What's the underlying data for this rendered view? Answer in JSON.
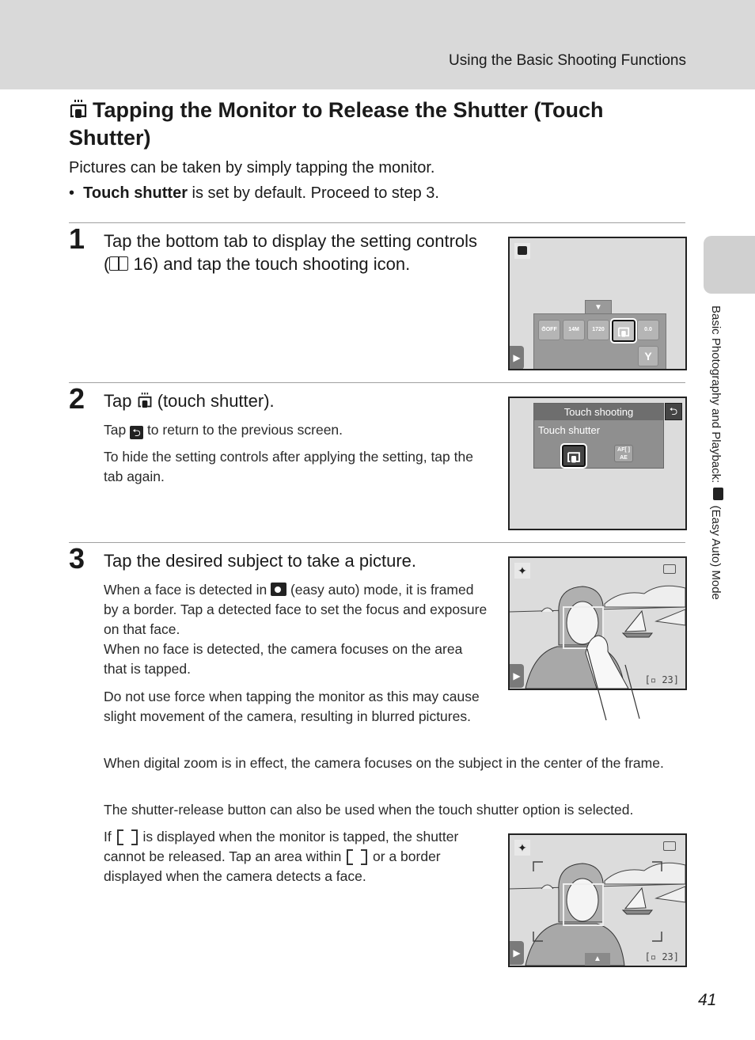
{
  "header": {
    "running_head": "Using the Basic Shooting Functions"
  },
  "side_tab": {
    "section_text_before": "Basic Photography and Playback: ",
    "section_icon": "easy-auto-camera-icon",
    "section_text_after": " (Easy Auto) Mode"
  },
  "title": {
    "icon": "touch-shutter-icon",
    "text": "Tapping the Monitor to Release the Shutter (Touch Shutter)"
  },
  "intro": "Pictures can be taken by simply tapping the monitor.",
  "bullet": {
    "bold": "Touch shutter",
    "rest": " is set by default. Proceed to step 3."
  },
  "steps": [
    {
      "number": "1",
      "title": "Tap the bottom tab to display the setting controls (",
      "ref_icon": "book-reference-icon",
      "title_ref": " 16) and tap the touch shooting icon.",
      "screen": {
        "buttons": [
          {
            "icon": "self-timer-icon",
            "value": "OFF"
          },
          {
            "icon": "image-mode-icon",
            "value": "14M"
          },
          {
            "icon": "movie-icon",
            "value": "1720"
          },
          {
            "icon": "touch-shutter-icon",
            "value": "",
            "selected": true
          },
          {
            "icon": "exposure-compensation-icon",
            "value": "0.0"
          }
        ],
        "setup_icon": "wrench-icon"
      }
    },
    {
      "number": "2",
      "title_before": "Tap ",
      "title_after": " (touch shutter).",
      "para1_before": "Tap ",
      "para1_after": " to return to the previous screen.",
      "para2": "To hide the setting controls after applying the setting, tap the tab again.",
      "screen": {
        "menu_title": "Touch shooting",
        "option_label": "Touch shutter",
        "option2_text": "AF[ ] AE"
      }
    },
    {
      "number": "3",
      "title": "Tap the desired subject to take a picture.",
      "para1_before": "When a face is detected in ",
      "para1_after": " (easy auto) mode, it is framed by a border. Tap a detected face to set the focus and exposure on that face.",
      "para1b": "When no face is detected, the camera focuses on the area that is tapped.",
      "para2": "Do not use force when tapping the monitor as this may cause slight movement of the camera, resulting in blurred pictures.",
      "para3": "When digital zoom is in effect, the camera focuses on the subject in the center of the frame.",
      "para4": "The shutter-release button can also be used when the touch shutter option is selected.",
      "para5_a": "If ",
      "para5_b": " is displayed when the monitor is tapped, the shutter cannot be released. Tap an area within ",
      "para5_c": " or a border displayed when the camera detects a face.",
      "screen": {
        "frames_remaining": "23"
      }
    }
  ],
  "page_number": "41"
}
